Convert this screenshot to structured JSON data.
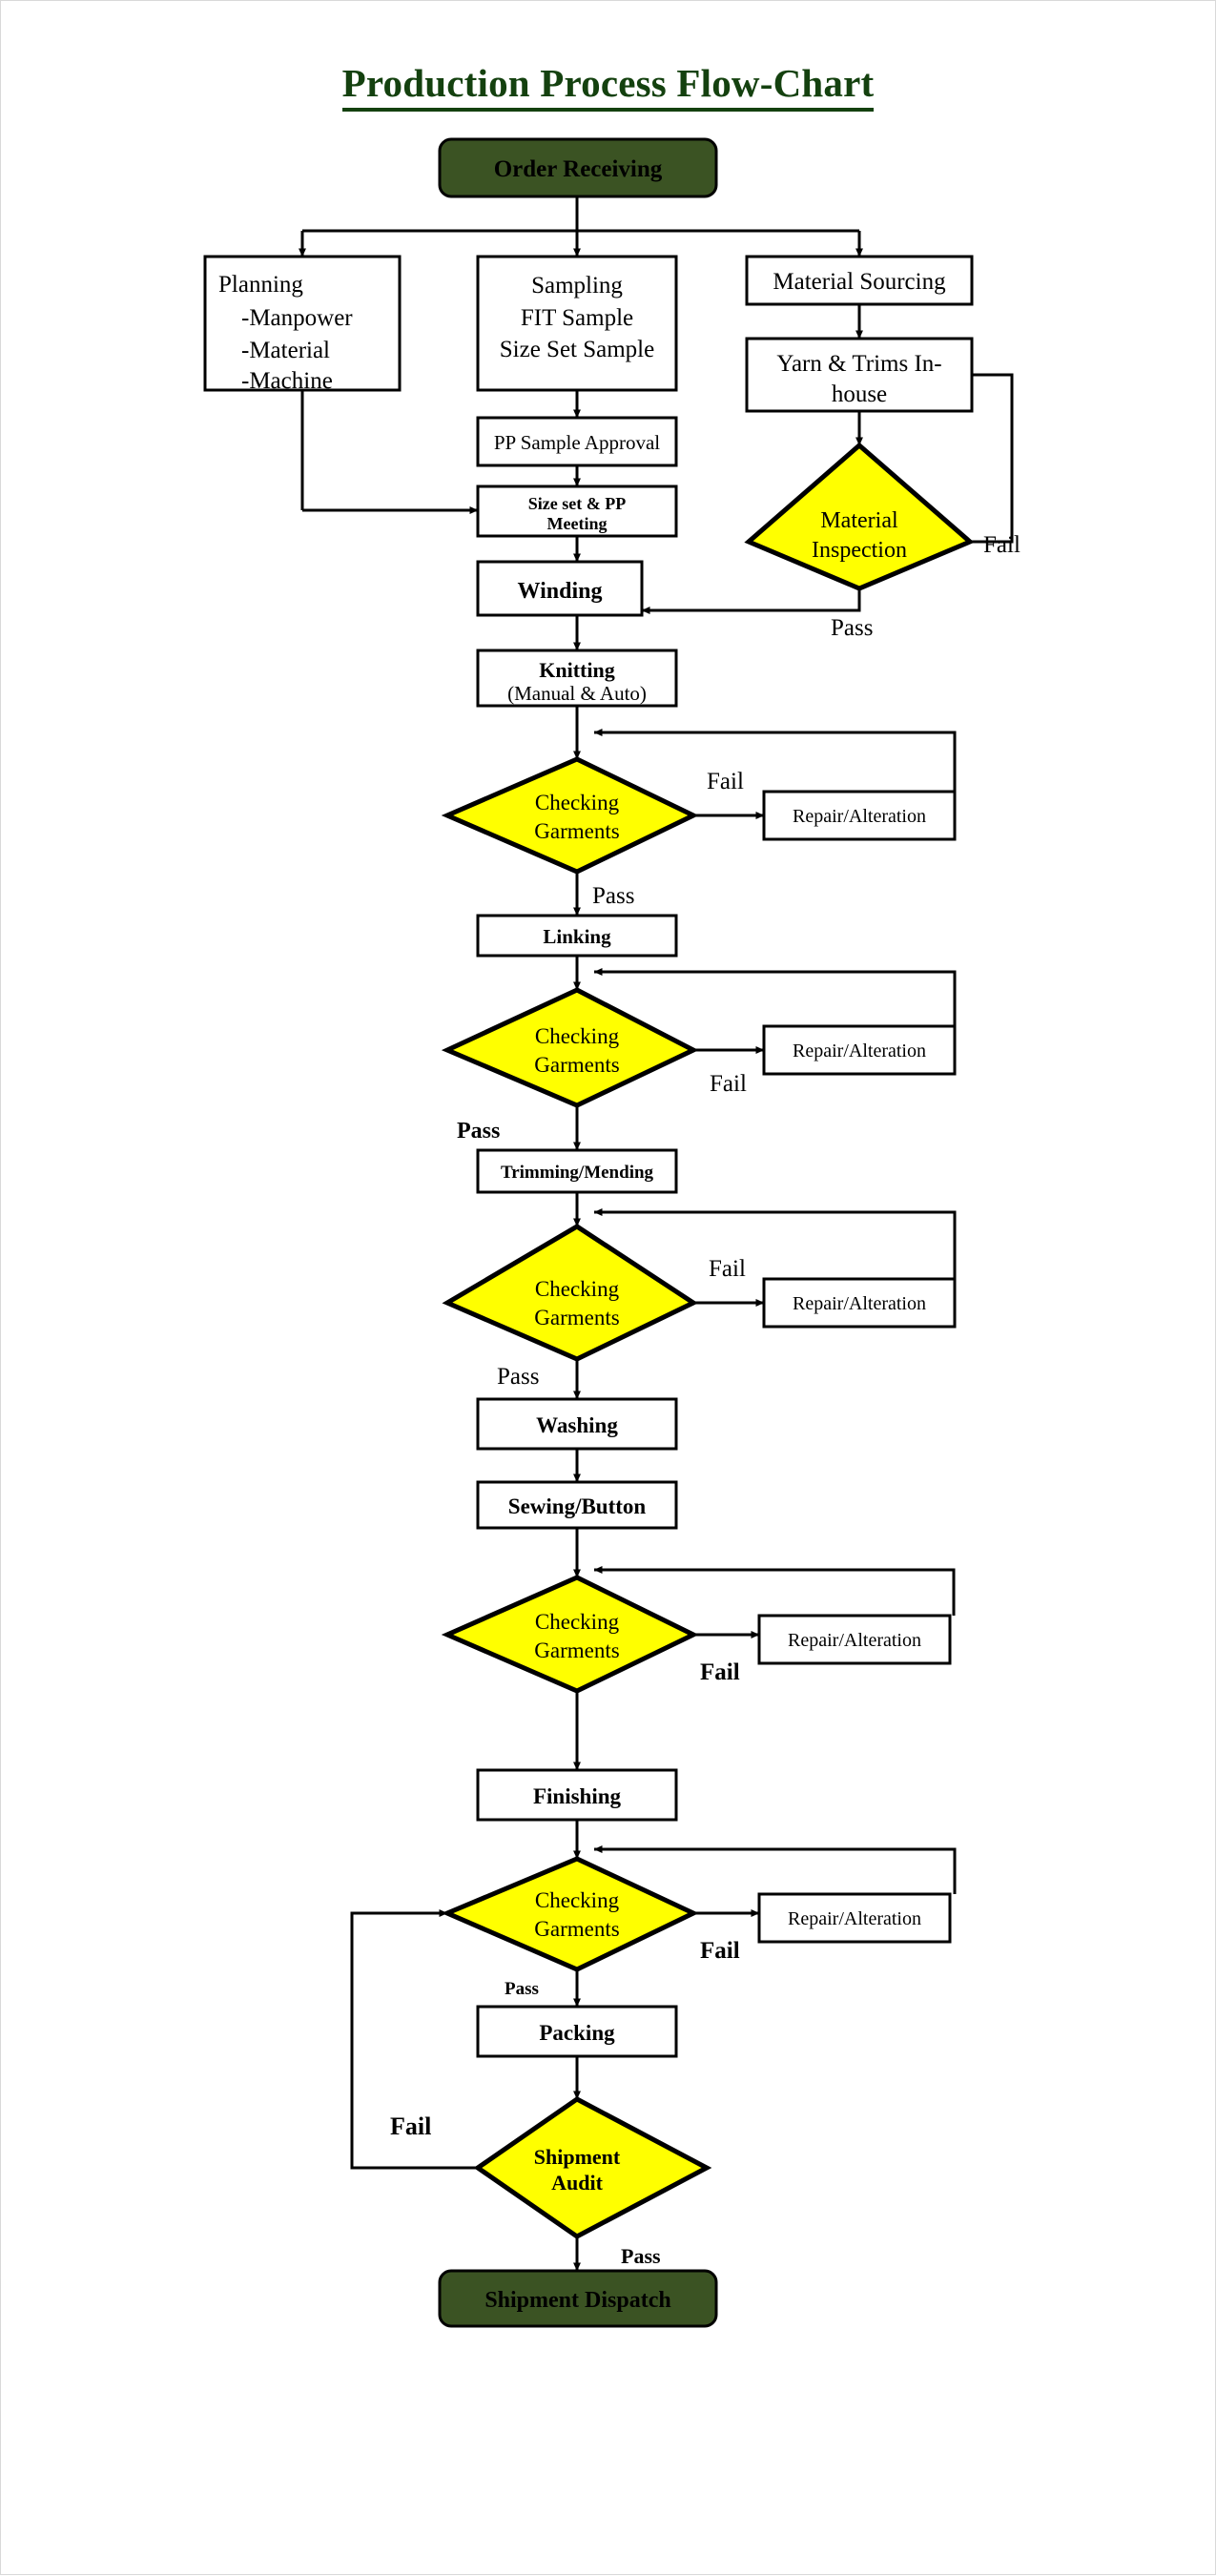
{
  "page": {
    "title": "Production Process Flow-Chart",
    "colors": {
      "terminator_fill": "#3b5323",
      "terminator_text": "#f2f4ef",
      "decision_fill": "#ffff00",
      "decision_text": "#231f00",
      "process_fill": "#ffffff",
      "process_text": "#000000",
      "line": "#000000",
      "title_text": "#14410f",
      "page_border": "#d9d9d9"
    }
  },
  "nodes": {
    "order_receiving": {
      "label": "Order Receiving",
      "type": "terminator"
    },
    "planning": {
      "type": "process",
      "title": "Planning",
      "items": [
        "-Manpower",
        "-Material",
        "-Machine"
      ]
    },
    "sampling": {
      "type": "process",
      "lines": [
        "Sampling",
        "FIT Sample",
        "Size Set Sample"
      ]
    },
    "material_sourcing": {
      "label": "Material Sourcing",
      "type": "process"
    },
    "yarn_trims": {
      "label": "Yarn & Trims In-house",
      "line1": "Yarn & Trims In-",
      "line2": "house",
      "type": "process"
    },
    "material_inspection": {
      "line1": "Material",
      "line2": "Inspection",
      "type": "decision"
    },
    "pp_sample_approval": {
      "label": "PP Sample Approval",
      "type": "process"
    },
    "size_set_pp_meeting": {
      "line1": "Size set & PP",
      "line2": "Meeting",
      "type": "process"
    },
    "winding": {
      "label": "Winding",
      "type": "process"
    },
    "knitting": {
      "line1": "Knitting",
      "line2": "(Manual & Auto)",
      "type": "process"
    },
    "checking_1": {
      "line1": "Checking",
      "line2": "Garments",
      "type": "decision"
    },
    "repair_1": {
      "label": "Repair/Alteration",
      "type": "process"
    },
    "linking": {
      "label": "Linking",
      "type": "process"
    },
    "checking_2": {
      "line1": "Checking",
      "line2": "Garments",
      "type": "decision"
    },
    "repair_2": {
      "label": "Repair/Alteration",
      "type": "process"
    },
    "trimming_mending": {
      "label": "Trimming/Mending",
      "type": "process"
    },
    "checking_3": {
      "line1": "Checking",
      "line2": "Garments",
      "type": "decision"
    },
    "repair_3": {
      "label": "Repair/Alteration",
      "type": "process"
    },
    "washing": {
      "label": "Washing",
      "type": "process"
    },
    "sewing_button": {
      "label": "Sewing/Button",
      "type": "process"
    },
    "checking_4": {
      "line1": "Checking",
      "line2": "Garments",
      "type": "decision"
    },
    "repair_4": {
      "label": "Repair/Alteration",
      "type": "process"
    },
    "finishing": {
      "label": "Finishing",
      "type": "process"
    },
    "checking_5": {
      "line1": "Checking",
      "line2": "Garments",
      "type": "decision"
    },
    "repair_5": {
      "label": "Repair/Alteration",
      "type": "process"
    },
    "packing": {
      "label": "Packing",
      "type": "process"
    },
    "shipment_audit": {
      "line1": "Shipment",
      "line2": "Audit",
      "type": "decision"
    },
    "shipment_dispatch": {
      "label": "Shipment Dispatch",
      "type": "terminator"
    }
  },
  "edge_labels": {
    "material_inspection_fail": "Fail",
    "material_inspection_pass": "Pass",
    "checking_1_fail": "Fail",
    "checking_1_pass": "Pass",
    "checking_2_fail": "Fail",
    "checking_2_pass": "Pass",
    "checking_3_fail": "Fail",
    "checking_3_pass": "Pass",
    "checking_4_fail": "Fail",
    "checking_5_fail": "Fail",
    "checking_5_pass": "Pass",
    "shipment_audit_fail": "Fail",
    "shipment_audit_pass": "Pass"
  }
}
